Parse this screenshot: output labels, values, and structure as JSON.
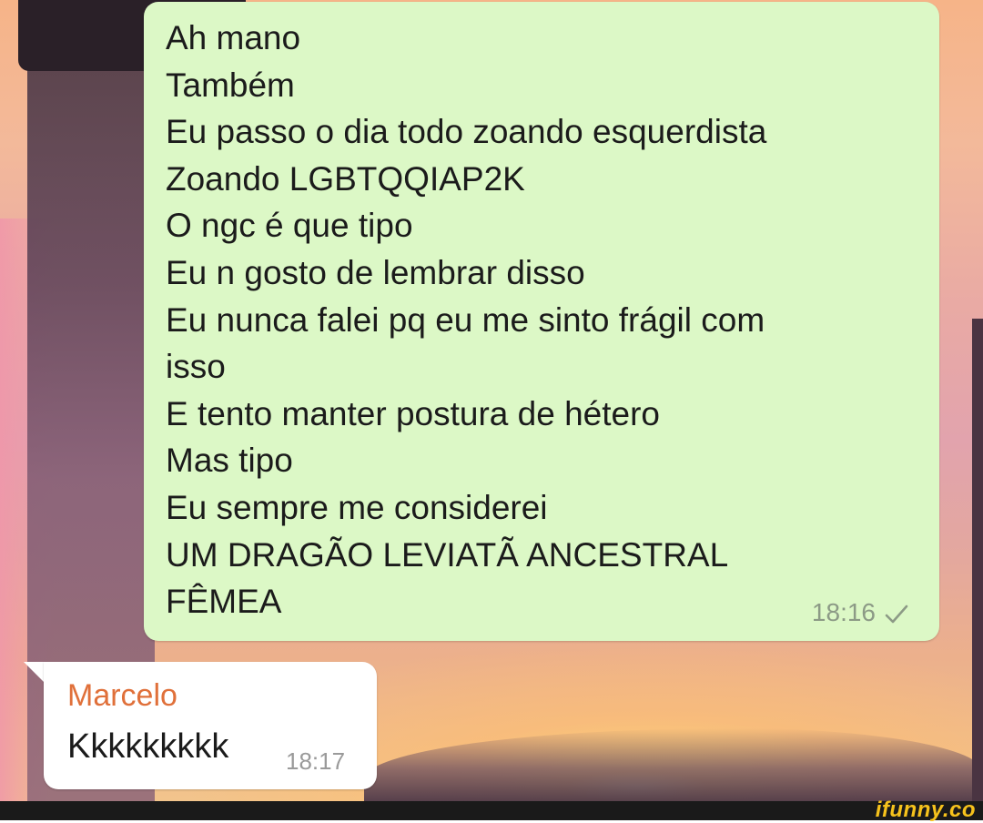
{
  "outgoing_message": {
    "lines": [
      "Ah mano",
      "Também",
      "Eu passo o dia todo zoando esquerdista",
      "Zoando LGBTQQIAP2K",
      "O ngc é que tipo",
      "Eu n gosto de lembrar disso",
      "Eu nunca falei pq eu me sinto frágil com",
      "isso",
      "E tento manter postura de hétero",
      "Mas tipo",
      "Eu sempre me considerei",
      "UM DRAGÃO LEVIATÃ ANCESTRAL",
      "FÊMEA"
    ],
    "time": "18:16",
    "status_icon": "single-check-icon"
  },
  "incoming_message": {
    "sender": "Marcelo",
    "text": "Kkkkkkkkk",
    "time": "18:17"
  },
  "watermark": {
    "text": "ifunny.co"
  },
  "colors": {
    "outgoing_bubble": "#dcf8c6",
    "incoming_bubble": "#ffffff",
    "sender_name": "#e0703a",
    "watermark": "#f6c21c"
  }
}
